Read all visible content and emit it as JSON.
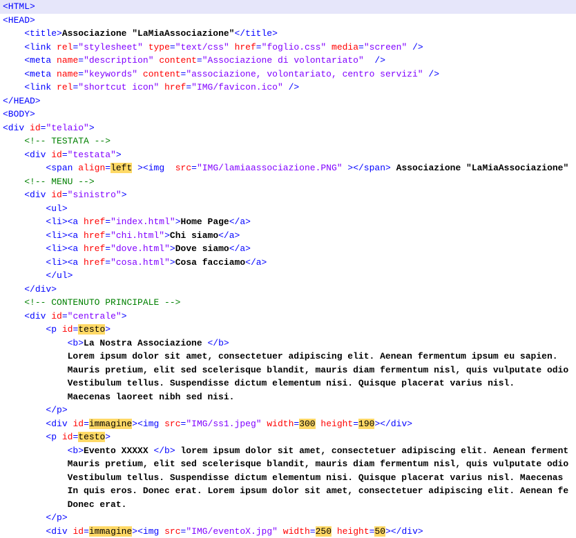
{
  "lines": [
    {
      "selected": true,
      "indent": 0,
      "spans": [
        {
          "c": "t-tag",
          "t": "<HTML>"
        }
      ]
    },
    {
      "indent": 0,
      "spans": [
        {
          "c": "t-tag",
          "t": "<HEAD>"
        }
      ]
    },
    {
      "indent": 1,
      "spans": [
        {
          "c": "t-tag",
          "t": "<title>"
        },
        {
          "c": "t-text",
          "t": "Associazione \"LaMiaAssociazione\""
        },
        {
          "c": "t-tag",
          "t": "</title>"
        }
      ]
    },
    {
      "indent": 1,
      "spans": [
        {
          "c": "t-tag",
          "t": "<link"
        },
        {
          "c": "",
          "t": " "
        },
        {
          "c": "t-attr",
          "t": "rel"
        },
        {
          "c": "t-tag",
          "t": "="
        },
        {
          "c": "t-val",
          "t": "\"stylesheet\""
        },
        {
          "c": "",
          "t": " "
        },
        {
          "c": "t-attr",
          "t": "type"
        },
        {
          "c": "t-tag",
          "t": "="
        },
        {
          "c": "t-val",
          "t": "\"text/css\""
        },
        {
          "c": "",
          "t": " "
        },
        {
          "c": "t-attr",
          "t": "href"
        },
        {
          "c": "t-tag",
          "t": "="
        },
        {
          "c": "t-val",
          "t": "\"foglio.css\""
        },
        {
          "c": "",
          "t": " "
        },
        {
          "c": "t-attr",
          "t": "media"
        },
        {
          "c": "t-tag",
          "t": "="
        },
        {
          "c": "t-val",
          "t": "\"screen\""
        },
        {
          "c": "",
          "t": " "
        },
        {
          "c": "t-tag",
          "t": "/>"
        }
      ]
    },
    {
      "indent": 1,
      "spans": [
        {
          "c": "t-tag",
          "t": "<meta"
        },
        {
          "c": "",
          "t": " "
        },
        {
          "c": "t-attr",
          "t": "name"
        },
        {
          "c": "t-tag",
          "t": "="
        },
        {
          "c": "t-val",
          "t": "\"description\""
        },
        {
          "c": "",
          "t": " "
        },
        {
          "c": "t-attr",
          "t": "content"
        },
        {
          "c": "t-tag",
          "t": "="
        },
        {
          "c": "t-val",
          "t": "\"Associazione di volontariato\""
        },
        {
          "c": "",
          "t": "  "
        },
        {
          "c": "t-tag",
          "t": "/>"
        }
      ]
    },
    {
      "indent": 1,
      "spans": [
        {
          "c": "t-tag",
          "t": "<meta"
        },
        {
          "c": "",
          "t": " "
        },
        {
          "c": "t-attr",
          "t": "name"
        },
        {
          "c": "t-tag",
          "t": "="
        },
        {
          "c": "t-val",
          "t": "\"keywords\""
        },
        {
          "c": "",
          "t": " "
        },
        {
          "c": "t-attr",
          "t": "content"
        },
        {
          "c": "t-tag",
          "t": "="
        },
        {
          "c": "t-val",
          "t": "\"associazione, volontariato, centro servizi\""
        },
        {
          "c": "",
          "t": " "
        },
        {
          "c": "t-tag",
          "t": "/>"
        }
      ]
    },
    {
      "indent": 1,
      "spans": [
        {
          "c": "t-tag",
          "t": "<link"
        },
        {
          "c": "",
          "t": " "
        },
        {
          "c": "t-attr",
          "t": "rel"
        },
        {
          "c": "t-tag",
          "t": "="
        },
        {
          "c": "t-val",
          "t": "\"shortcut icon\""
        },
        {
          "c": "",
          "t": " "
        },
        {
          "c": "t-attr",
          "t": "href"
        },
        {
          "c": "t-tag",
          "t": "="
        },
        {
          "c": "t-val",
          "t": "\"IMG/favicon.ico\""
        },
        {
          "c": "",
          "t": " "
        },
        {
          "c": "t-tag",
          "t": "/>"
        }
      ]
    },
    {
      "indent": 0,
      "spans": [
        {
          "c": "t-tag",
          "t": "</HEAD>"
        }
      ]
    },
    {
      "indent": 0,
      "spans": [
        {
          "c": "t-tag",
          "t": "<BODY>"
        }
      ]
    },
    {
      "indent": 0,
      "spans": [
        {
          "c": "t-tag",
          "t": "<div"
        },
        {
          "c": "",
          "t": " "
        },
        {
          "c": "t-attr",
          "t": "id"
        },
        {
          "c": "t-tag",
          "t": "="
        },
        {
          "c": "t-val",
          "t": "\"telaio\""
        },
        {
          "c": "t-tag",
          "t": ">"
        }
      ]
    },
    {
      "indent": 1,
      "spans": [
        {
          "c": "t-comment",
          "t": "<!-- TESTATA -->"
        }
      ]
    },
    {
      "indent": 1,
      "spans": [
        {
          "c": "t-tag",
          "t": "<div"
        },
        {
          "c": "",
          "t": " "
        },
        {
          "c": "t-attr",
          "t": "id"
        },
        {
          "c": "t-tag",
          "t": "="
        },
        {
          "c": "t-val",
          "t": "\"testata\""
        },
        {
          "c": "t-tag",
          "t": ">"
        }
      ]
    },
    {
      "indent": 2,
      "spans": [
        {
          "c": "t-tag",
          "t": "<span"
        },
        {
          "c": "",
          "t": " "
        },
        {
          "c": "t-attr",
          "t": "align"
        },
        {
          "c": "t-tag",
          "t": "="
        },
        {
          "c": "t-hl",
          "t": "left"
        },
        {
          "c": "",
          "t": " "
        },
        {
          "c": "t-tag",
          "t": "><img"
        },
        {
          "c": "",
          "t": "  "
        },
        {
          "c": "t-attr",
          "t": "src"
        },
        {
          "c": "t-tag",
          "t": "="
        },
        {
          "c": "t-val",
          "t": "\"IMG/lamiaassociazione.PNG\""
        },
        {
          "c": "",
          "t": " "
        },
        {
          "c": "t-tag",
          "t": "></span>"
        },
        {
          "c": "",
          "t": " "
        },
        {
          "c": "t-text",
          "t": "Associazione \"LaMiaAssociazione\""
        }
      ]
    },
    {
      "indent": 1,
      "spans": [
        {
          "c": "t-comment",
          "t": "<!-- MENU -->"
        }
      ]
    },
    {
      "indent": 1,
      "spans": [
        {
          "c": "t-tag",
          "t": "<div"
        },
        {
          "c": "",
          "t": " "
        },
        {
          "c": "t-attr",
          "t": "id"
        },
        {
          "c": "t-tag",
          "t": "="
        },
        {
          "c": "t-val",
          "t": "\"sinistro\""
        },
        {
          "c": "t-tag",
          "t": ">"
        }
      ]
    },
    {
      "indent": 2,
      "spans": [
        {
          "c": "t-tag",
          "t": "<ul>"
        }
      ]
    },
    {
      "indent": 2,
      "spans": [
        {
          "c": "t-tag",
          "t": "<li><a"
        },
        {
          "c": "",
          "t": " "
        },
        {
          "c": "t-attr",
          "t": "href"
        },
        {
          "c": "t-tag",
          "t": "="
        },
        {
          "c": "t-val",
          "t": "\"index.html\""
        },
        {
          "c": "t-tag",
          "t": ">"
        },
        {
          "c": "t-text",
          "t": "Home Page"
        },
        {
          "c": "t-tag",
          "t": "</a>"
        }
      ]
    },
    {
      "indent": 2,
      "spans": [
        {
          "c": "t-tag",
          "t": "<li><a"
        },
        {
          "c": "",
          "t": " "
        },
        {
          "c": "t-attr",
          "t": "href"
        },
        {
          "c": "t-tag",
          "t": "="
        },
        {
          "c": "t-val",
          "t": "\"chi.html\""
        },
        {
          "c": "t-tag",
          "t": ">"
        },
        {
          "c": "t-text",
          "t": "Chi siamo"
        },
        {
          "c": "t-tag",
          "t": "</a>"
        }
      ]
    },
    {
      "indent": 2,
      "spans": [
        {
          "c": "t-tag",
          "t": "<li><a"
        },
        {
          "c": "",
          "t": " "
        },
        {
          "c": "t-attr",
          "t": "href"
        },
        {
          "c": "t-tag",
          "t": "="
        },
        {
          "c": "t-val",
          "t": "\"dove.html\""
        },
        {
          "c": "t-tag",
          "t": ">"
        },
        {
          "c": "t-text",
          "t": "Dove siamo"
        },
        {
          "c": "t-tag",
          "t": "</a>"
        }
      ]
    },
    {
      "indent": 2,
      "spans": [
        {
          "c": "t-tag",
          "t": "<li><a"
        },
        {
          "c": "",
          "t": " "
        },
        {
          "c": "t-attr",
          "t": "href"
        },
        {
          "c": "t-tag",
          "t": "="
        },
        {
          "c": "t-val",
          "t": "\"cosa.html\""
        },
        {
          "c": "t-tag",
          "t": ">"
        },
        {
          "c": "t-text",
          "t": "Cosa facciamo"
        },
        {
          "c": "t-tag",
          "t": "</a>"
        }
      ]
    },
    {
      "indent": 2,
      "spans": [
        {
          "c": "t-tag",
          "t": "</ul>"
        }
      ]
    },
    {
      "indent": 1,
      "spans": [
        {
          "c": "t-tag",
          "t": "</div>"
        }
      ]
    },
    {
      "indent": 1,
      "spans": [
        {
          "c": "t-comment",
          "t": "<!-- CONTENUTO PRINCIPALE -->"
        }
      ]
    },
    {
      "indent": 1,
      "spans": [
        {
          "c": "t-tag",
          "t": "<div"
        },
        {
          "c": "",
          "t": " "
        },
        {
          "c": "t-attr",
          "t": "id"
        },
        {
          "c": "t-tag",
          "t": "="
        },
        {
          "c": "t-val",
          "t": "\"centrale\""
        },
        {
          "c": "t-tag",
          "t": ">"
        }
      ]
    },
    {
      "indent": 2,
      "spans": [
        {
          "c": "t-tag",
          "t": "<p"
        },
        {
          "c": "",
          "t": " "
        },
        {
          "c": "t-attr",
          "t": "id"
        },
        {
          "c": "t-tag",
          "t": "="
        },
        {
          "c": "t-hl",
          "t": "testo"
        },
        {
          "c": "t-tag",
          "t": ">"
        }
      ]
    },
    {
      "indent": 3,
      "spans": [
        {
          "c": "t-tag",
          "t": "<b>"
        },
        {
          "c": "t-text",
          "t": "La Nostra Associazione "
        },
        {
          "c": "t-tag",
          "t": "</b>"
        }
      ]
    },
    {
      "indent": 3,
      "spans": [
        {
          "c": "t-text",
          "t": "Lorem ipsum dolor sit amet, consectetuer adipiscing elit. Aenean fermentum ipsum eu sapien."
        }
      ]
    },
    {
      "indent": 3,
      "spans": [
        {
          "c": "t-text",
          "t": "Mauris pretium, elit sed scelerisque blandit, mauris diam fermentum nisl, quis vulputate odio"
        }
      ]
    },
    {
      "indent": 3,
      "spans": [
        {
          "c": "t-text",
          "t": "Vestibulum tellus. Suspendisse dictum elementum nisi. Quisque placerat varius nisl."
        }
      ]
    },
    {
      "indent": 3,
      "spans": [
        {
          "c": "t-text",
          "t": "Maecenas laoreet nibh sed nisi."
        }
      ]
    },
    {
      "indent": 2,
      "spans": [
        {
          "c": "t-tag",
          "t": "</p>"
        }
      ]
    },
    {
      "indent": 2,
      "spans": [
        {
          "c": "t-tag",
          "t": "<div"
        },
        {
          "c": "",
          "t": " "
        },
        {
          "c": "t-attr",
          "t": "id"
        },
        {
          "c": "t-tag",
          "t": "="
        },
        {
          "c": "t-hl",
          "t": "immagine"
        },
        {
          "c": "t-tag",
          "t": "><img"
        },
        {
          "c": "",
          "t": " "
        },
        {
          "c": "t-attr",
          "t": "src"
        },
        {
          "c": "t-tag",
          "t": "="
        },
        {
          "c": "t-val",
          "t": "\"IMG/ss1.jpeg\""
        },
        {
          "c": "",
          "t": " "
        },
        {
          "c": "t-attr",
          "t": "width"
        },
        {
          "c": "t-tag",
          "t": "="
        },
        {
          "c": "t-hl",
          "t": "300"
        },
        {
          "c": "",
          "t": " "
        },
        {
          "c": "t-attr",
          "t": "height"
        },
        {
          "c": "t-tag",
          "t": "="
        },
        {
          "c": "t-hl",
          "t": "190"
        },
        {
          "c": "t-tag",
          "t": "></div>"
        }
      ]
    },
    {
      "indent": 2,
      "spans": [
        {
          "c": "t-tag",
          "t": "<p"
        },
        {
          "c": "",
          "t": " "
        },
        {
          "c": "t-attr",
          "t": "id"
        },
        {
          "c": "t-tag",
          "t": "="
        },
        {
          "c": "t-hl",
          "t": "testo"
        },
        {
          "c": "t-tag",
          "t": ">"
        }
      ]
    },
    {
      "indent": 3,
      "spans": [
        {
          "c": "t-tag",
          "t": "<b>"
        },
        {
          "c": "t-text",
          "t": "Evento XXXXX "
        },
        {
          "c": "t-tag",
          "t": "</b>"
        },
        {
          "c": "",
          "t": " "
        },
        {
          "c": "t-text",
          "t": "lorem ipsum dolor sit amet, consectetuer adipiscing elit. Aenean ferment"
        }
      ]
    },
    {
      "indent": 3,
      "spans": [
        {
          "c": "t-text",
          "t": "Mauris pretium, elit sed scelerisque blandit, mauris diam fermentum nisl, quis vulputate odio"
        }
      ]
    },
    {
      "indent": 3,
      "spans": [
        {
          "c": "t-text",
          "t": "Vestibulum tellus. Suspendisse dictum elementum nisi. Quisque placerat varius nisl. Maecenas"
        }
      ]
    },
    {
      "indent": 3,
      "spans": [
        {
          "c": "t-text",
          "t": "In quis eros. Donec erat. Lorem ipsum dolor sit amet, consectetuer adipiscing elit. Aenean fe"
        }
      ]
    },
    {
      "indent": 3,
      "spans": [
        {
          "c": "t-text",
          "t": "Donec erat."
        }
      ]
    },
    {
      "indent": 2,
      "spans": [
        {
          "c": "t-tag",
          "t": "</p>"
        }
      ]
    },
    {
      "indent": 2,
      "spans": [
        {
          "c": "t-tag",
          "t": "<div"
        },
        {
          "c": "",
          "t": " "
        },
        {
          "c": "t-attr",
          "t": "id"
        },
        {
          "c": "t-tag",
          "t": "="
        },
        {
          "c": "t-hl",
          "t": "immagine"
        },
        {
          "c": "t-tag",
          "t": "><img"
        },
        {
          "c": "",
          "t": " "
        },
        {
          "c": "t-attr",
          "t": "src"
        },
        {
          "c": "t-tag",
          "t": "="
        },
        {
          "c": "t-val",
          "t": "\"IMG/eventoX.jpg\""
        },
        {
          "c": "",
          "t": " "
        },
        {
          "c": "t-attr",
          "t": "width"
        },
        {
          "c": "t-tag",
          "t": "="
        },
        {
          "c": "t-hl",
          "t": "250"
        },
        {
          "c": "",
          "t": " "
        },
        {
          "c": "t-attr",
          "t": "height"
        },
        {
          "c": "t-tag",
          "t": "="
        },
        {
          "c": "t-hl",
          "t": "50"
        },
        {
          "c": "t-tag",
          "t": "></div>"
        }
      ]
    }
  ],
  "indent_unit": "    "
}
